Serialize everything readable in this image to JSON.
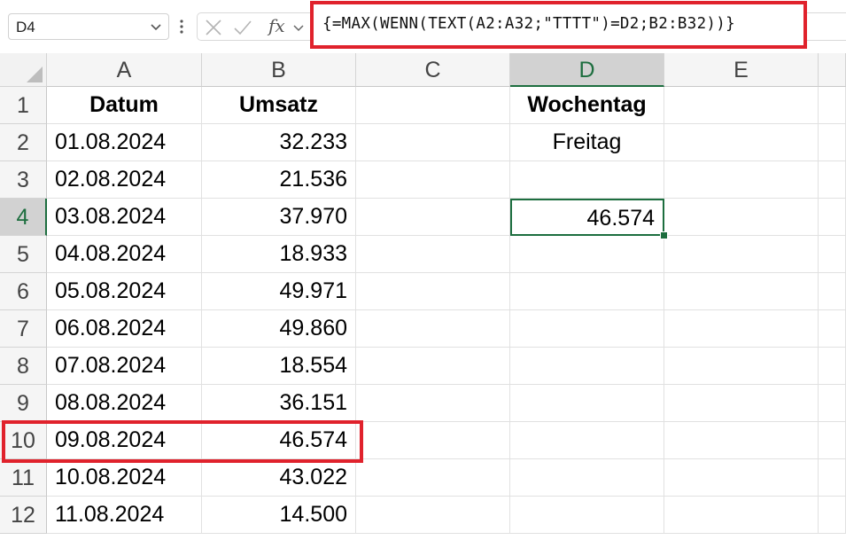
{
  "formula_bar": {
    "name_box": "D4",
    "fx_label": "fx",
    "formula": "{=MAX(WENN(TEXT(A2:A32;\"TTTT\")=D2;B2:B32))}"
  },
  "columns": [
    "A",
    "B",
    "C",
    "D",
    "E"
  ],
  "selected_cell": "D4",
  "rows": [
    {
      "num": "1",
      "A": "Datum",
      "B": "Umsatz",
      "D": "Wochentag"
    },
    {
      "num": "2",
      "A": "01.08.2024",
      "B": "32.233",
      "D": "Freitag"
    },
    {
      "num": "3",
      "A": "02.08.2024",
      "B": "21.536",
      "D": ""
    },
    {
      "num": "4",
      "A": "03.08.2024",
      "B": "37.970",
      "D": "46.574"
    },
    {
      "num": "5",
      "A": "04.08.2024",
      "B": "18.933",
      "D": ""
    },
    {
      "num": "6",
      "A": "05.08.2024",
      "B": "49.971",
      "D": ""
    },
    {
      "num": "7",
      "A": "06.08.2024",
      "B": "49.860",
      "D": ""
    },
    {
      "num": "8",
      "A": "07.08.2024",
      "B": "18.554",
      "D": ""
    },
    {
      "num": "9",
      "A": "08.08.2024",
      "B": "36.151",
      "D": ""
    },
    {
      "num": "10",
      "A": "09.08.2024",
      "B": "46.574",
      "D": ""
    },
    {
      "num": "11",
      "A": "10.08.2024",
      "B": "43.022",
      "D": ""
    },
    {
      "num": "12",
      "A": "11.08.2024",
      "B": "14.500",
      "D": ""
    }
  ],
  "colors": {
    "highlight": "#e0222c",
    "selection": "#1d6e3f"
  }
}
